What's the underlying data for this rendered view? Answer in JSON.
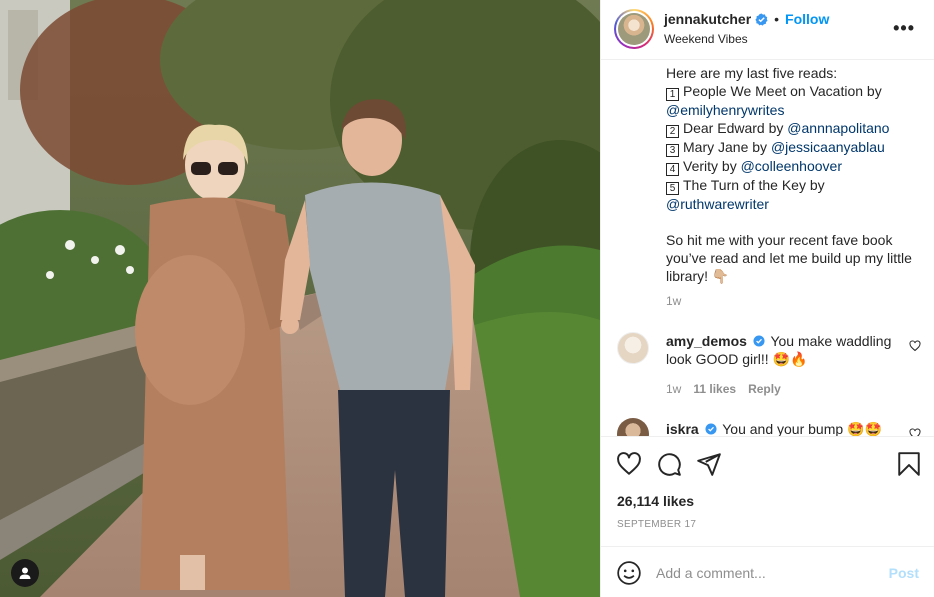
{
  "post": {
    "username": "jennakutcher",
    "follow_label": "Follow",
    "separator": "•",
    "location": "Weekend Vibes",
    "more_label": "•••",
    "verified_icon": "verified-badge-icon"
  },
  "caption": {
    "intro": "Here are my last five reads:",
    "items": [
      {
        "num": "1",
        "text1": "People We Meet on Vacation by",
        "mention": "@emilyhenrywrites"
      },
      {
        "num": "2",
        "text": "Dear Edward by ",
        "mention": "@annnapolitano"
      },
      {
        "num": "3",
        "text": "Mary Jane by ",
        "mention": "@jessicaanyablau"
      },
      {
        "num": "4",
        "text": "Verity by ",
        "mention": "@colleenhoover"
      },
      {
        "num": "5",
        "text1": "The Turn of the Key by",
        "mention": "@ruthwarewriter"
      }
    ],
    "outro_line1": "So hit me with your recent fave book",
    "outro_line2": "you’ve read and let me build up my little",
    "outro_line3": "library! 👇🏼",
    "time": "1w"
  },
  "comments": [
    {
      "username": "amy_demos",
      "text_line1": "You make waddling",
      "text_line2": "look GOOD girl!! 🤩🔥",
      "time": "1w",
      "likes": "11 likes",
      "reply": "Reply"
    },
    {
      "username": "iskra",
      "text_line1": "You and your bump 🤩🤩"
    }
  ],
  "engagement": {
    "likes": "26,114 likes",
    "date": "SEPTEMBER 17"
  },
  "composer": {
    "placeholder": "Add a comment...",
    "post_label": "Post"
  },
  "colors": {
    "accent": "#0095f6",
    "mention": "#00376b",
    "muted": "#8e8e8e",
    "post_disabled": "#b2dffc"
  }
}
